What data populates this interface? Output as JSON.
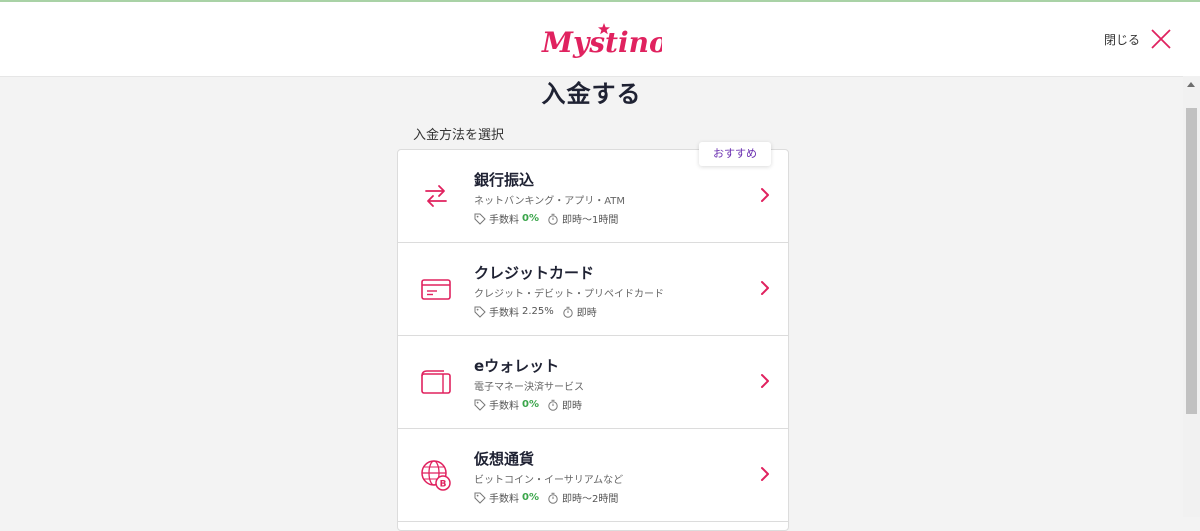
{
  "header": {
    "logo_text": "Mystino",
    "close_label": "閉じる"
  },
  "page": {
    "title": "入金する",
    "section_label": "入金方法を選択",
    "badge": "おすすめ"
  },
  "colors": {
    "brand": "#e0225f",
    "accent_purple": "#6a2fb0",
    "fee_green": "#3aa54a"
  },
  "methods": [
    {
      "title": "銀行振込",
      "subtitle": "ネットバンキング・アプリ・ATM",
      "fee_label": "手数料",
      "fee_value": "0%",
      "time": "即時〜1時間",
      "icon": "transfer-arrows-icon"
    },
    {
      "title": "クレジットカード",
      "subtitle": "クレジット・デビット・プリペイドカード",
      "fee_label": "手数料",
      "fee_value": "2.25%",
      "time": "即時",
      "icon": "credit-card-icon"
    },
    {
      "title": "eウォレット",
      "subtitle": "電子マネー決済サービス",
      "fee_label": "手数料",
      "fee_value": "0%",
      "time": "即時",
      "icon": "wallet-icon"
    },
    {
      "title": "仮想通貨",
      "subtitle": "ビットコイン・イーサリアムなど",
      "fee_label": "手数料",
      "fee_value": "0%",
      "time": "即時〜2時間",
      "icon": "crypto-globe-icon"
    }
  ]
}
